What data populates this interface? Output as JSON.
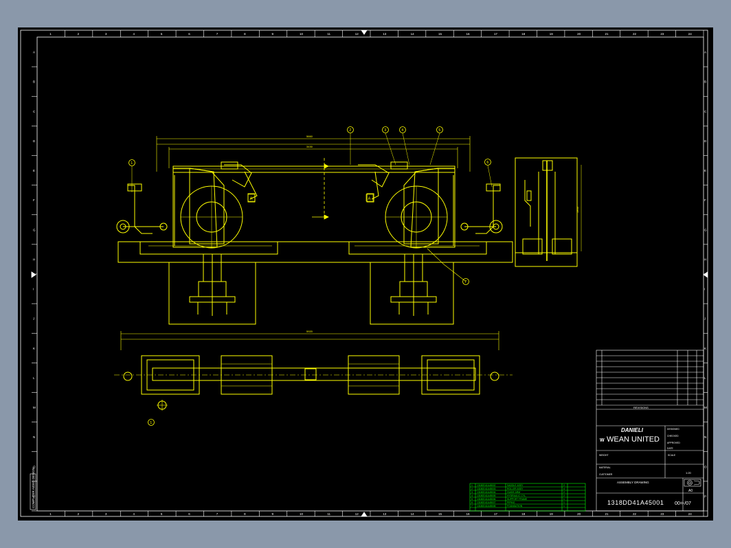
{
  "drawing": {
    "background_color": "#000000",
    "window_color": "#8a98aa",
    "line_colors": {
      "frame": "#ffffff",
      "geometry": "#ffff00",
      "bom": "#00ff00"
    },
    "frame_col_labels": [
      "1",
      "2",
      "3",
      "4",
      "5",
      "6",
      "7",
      "8",
      "9",
      "10",
      "11",
      "12",
      "13",
      "14",
      "15",
      "16",
      "17",
      "18",
      "19",
      "20",
      "21",
      "22",
      "23",
      "24"
    ],
    "frame_row_labels": [
      "A",
      "B",
      "C",
      "D",
      "E",
      "F",
      "G",
      "H",
      "I",
      "J",
      "K",
      "L",
      "M",
      "N",
      "O",
      "P"
    ],
    "balloons": [
      "1",
      "2",
      "3",
      "4",
      "5",
      "6",
      "7"
    ],
    "view_markers": [
      "A",
      "A"
    ],
    "dimensions": {
      "overall_width": "5660",
      "top_span": "3430",
      "plan_overall": "5920",
      "side_height": "1900"
    },
    "side_tag": "COMPUTER AIDED DESIGN"
  },
  "title_block": {
    "company": "DANIELI",
    "brand": "WEAN UNITED",
    "drawing_title": "ASSEMBLY DRAWING",
    "drawing_number": "1318DD41A45001",
    "sheet_size": "A0",
    "sheet_ref": "00=-/07",
    "scale": "1:20",
    "rev_header": "REVISIONS",
    "fields": [
      "DESIGNED",
      "CHECKED",
      "APPROVED",
      "DATE",
      "SCALE",
      "WEIGHT",
      "MATERIAL",
      "CUSTOMER"
    ]
  },
  "bom_rows": [
    {
      "pos": "1",
      "code": "13180D41A45002",
      "desc": "SADDLE ASSY",
      "qty": "2"
    },
    {
      "pos": "2",
      "code": "13180D41A45003",
      "desc": "ROLLER ASSY",
      "qty": "4"
    },
    {
      "pos": "3",
      "code": "13180D41A45004",
      "desc": "GUIDE ARM",
      "qty": "2"
    },
    {
      "pos": "4",
      "code": "13180D41A45005",
      "desc": "HYDRAULIC CYL.",
      "qty": "2"
    },
    {
      "pos": "5",
      "code": "13180D41A45006",
      "desc": "SUPPORT FRAME",
      "qty": "1"
    },
    {
      "pos": "6",
      "code": "13180D41A45007",
      "desc": "PIPING",
      "qty": "1"
    },
    {
      "pos": "7",
      "code": "13180D41A45008",
      "desc": "FOUNDATION",
      "qty": "1"
    }
  ]
}
